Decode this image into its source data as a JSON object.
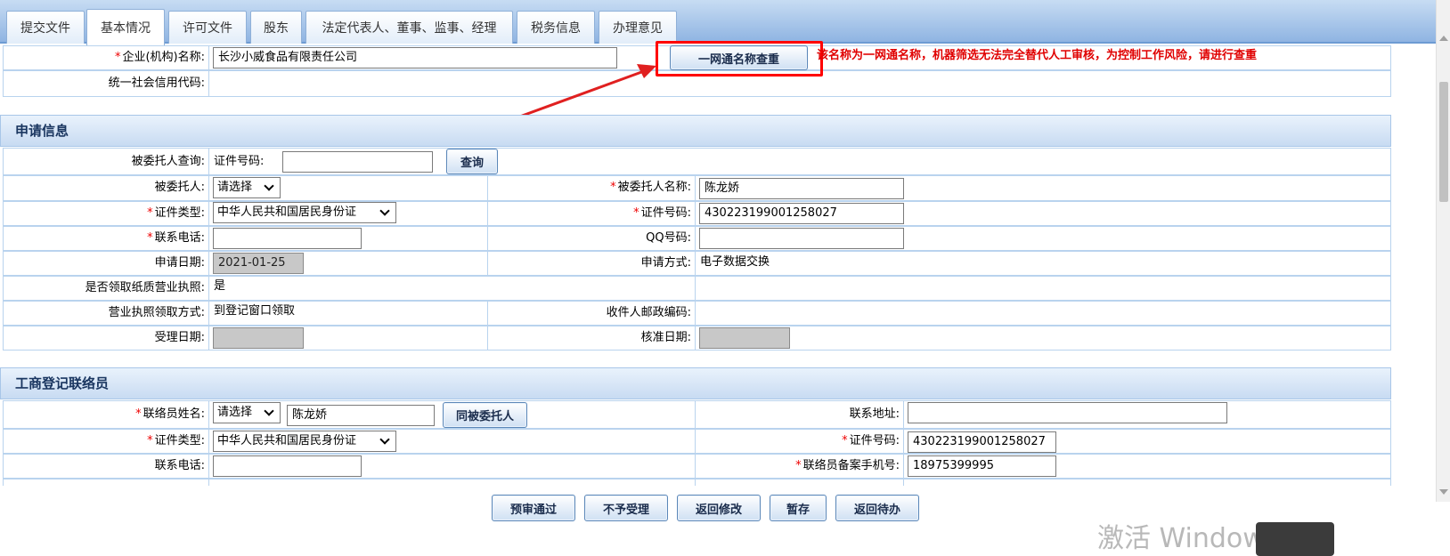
{
  "tabs": [
    {
      "label": "提交文件"
    },
    {
      "label": "基本情况",
      "active": true
    },
    {
      "label": "许可文件"
    },
    {
      "label": "股东"
    },
    {
      "label": "法定代表人、董事、监事、经理"
    },
    {
      "label": "税务信息"
    },
    {
      "label": "办理意见"
    }
  ],
  "company": {
    "required_mark": "*",
    "name_label": "企业(机构)名称:",
    "name_value": "长沙小威食品有限责任公司",
    "check_button": "一网通名称查重",
    "warning": "该名称为一网通名称，机器筛选无法完全替代人工审核，为控制工作风险，请进行查重",
    "credit_code_label": "统一社会信用代码:",
    "credit_code_value": ""
  },
  "application": {
    "section_title": "申请信息",
    "agent_query_label": "被委托人查询:",
    "id_no_inline_label": "证件号码:",
    "id_no_query_value": "",
    "query_button": "查询",
    "agent_label": "被委托人:",
    "agent_select": "请选择",
    "agent_name_label": "被委托人名称:",
    "agent_name_value": "陈龙娇",
    "id_type_label": "证件类型:",
    "id_type_value": "中华人民共和国居民身份证",
    "id_no_label": "证件号码:",
    "id_no_value": "430223199001258027",
    "phone_label": "联系电话:",
    "phone_value": "",
    "qq_label": "QQ号码:",
    "qq_value": "",
    "apply_date_label": "申请日期:",
    "apply_date_value": "2021-01-25",
    "apply_method_label": "申请方式:",
    "apply_method_value": "电子数据交换",
    "paper_license_label": "是否领取纸质营业执照:",
    "paper_license_value": "是",
    "license_pickup_label": "营业执照领取方式:",
    "license_pickup_value": "到登记窗口领取",
    "postal_code_label": "收件人邮政编码:",
    "postal_code_value": "",
    "accept_date_label": "受理日期:",
    "accept_date_value": "",
    "approve_date_label": "核准日期:",
    "approve_date_value": ""
  },
  "liaison": {
    "section_title": "工商登记联络员",
    "name_label": "联络员姓名:",
    "name_select": "请选择",
    "name_value": "陈龙娇",
    "same_button": "同被委托人",
    "address_label": "联系地址:",
    "address_value": "",
    "id_type_label": "证件类型:",
    "id_type_value": "中华人民共和国居民身份证",
    "id_no_label": "证件号码:",
    "id_no_value": "430223199001258027",
    "phone_label": "联系电话:",
    "phone_value": "",
    "mobile_label": "联络员备案手机号:",
    "mobile_value": "18975399995"
  },
  "actions": {
    "pre_approve": "预审通过",
    "reject": "不予受理",
    "return_edit": "返回修改",
    "save_temp": "暂存",
    "return_todo": "返回待办"
  },
  "system": {
    "watermark": "激活 Windows"
  },
  "colors": {
    "accent": "#1a3660",
    "warning": "#e00000",
    "highlight_box": "#ff0000",
    "arrow": "#e02020"
  }
}
